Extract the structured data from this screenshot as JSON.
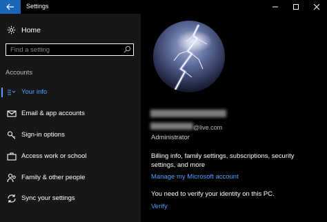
{
  "window": {
    "title": "Settings"
  },
  "sidebar": {
    "home_label": "Home",
    "search_placeholder": "Find a setting",
    "section_label": "Accounts",
    "items": [
      {
        "label": "Your info",
        "icon": "contact-card-icon",
        "active": true
      },
      {
        "label": "Email & app accounts",
        "icon": "mail-icon"
      },
      {
        "label": "Sign-in options",
        "icon": "key-icon"
      },
      {
        "label": "Access work or school",
        "icon": "briefcase-icon"
      },
      {
        "label": "Family & other people",
        "icon": "people-icon"
      },
      {
        "label": "Sync your settings",
        "icon": "sync-icon"
      }
    ]
  },
  "main": {
    "email_suffix": "@live.com",
    "role": "Administrator",
    "billing_text": "Billing info, family settings, subscriptions, security settings, and more",
    "manage_link": "Manage my Microsoft account",
    "verify_text": "You need to verify your identity on this PC.",
    "verify_link": "Verify"
  },
  "colors": {
    "accent": "#4da3ff",
    "back_button": "#1a66b8",
    "sidebar_bg": "#171717"
  }
}
